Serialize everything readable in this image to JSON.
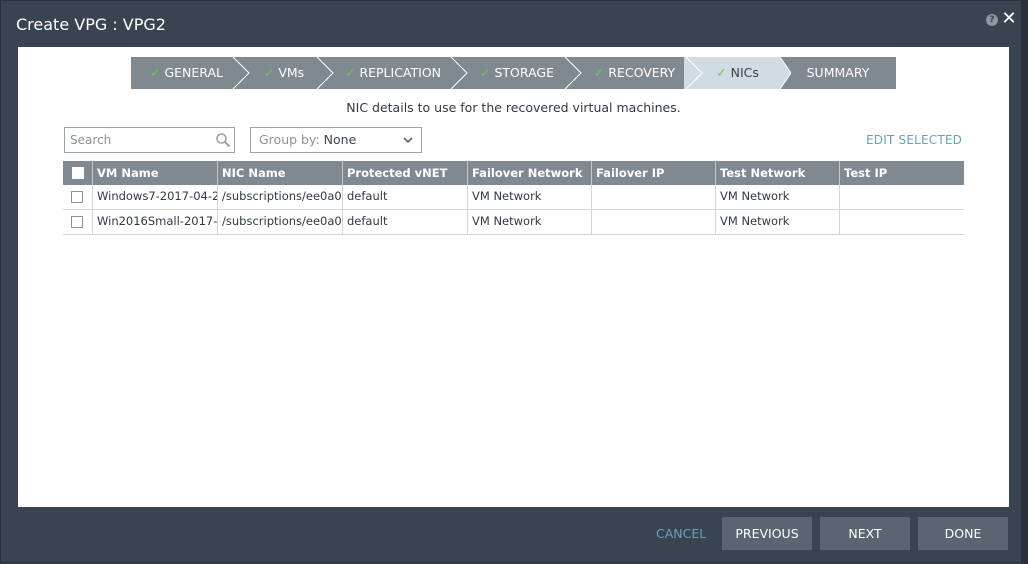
{
  "window": {
    "title": "Create VPG : VPG2",
    "help_icon": "?",
    "close_icon": "✕"
  },
  "wizard": {
    "steps": [
      {
        "label": "GENERAL",
        "done": true
      },
      {
        "label": "VMs",
        "done": true
      },
      {
        "label": "REPLICATION",
        "done": true
      },
      {
        "label": "STORAGE",
        "done": true
      },
      {
        "label": "RECOVERY",
        "done": true
      },
      {
        "label": "NICs",
        "done": true,
        "active": true
      },
      {
        "label": "SUMMARY",
        "done": false
      }
    ],
    "check_glyph": "✓"
  },
  "subtitle": "NIC details to use for the recovered virtual machines.",
  "toolbar": {
    "search_placeholder": "Search",
    "group_by_label": "Group by:",
    "group_by_value": "None",
    "edit_selected": "EDIT SELECTED"
  },
  "table": {
    "columns": [
      "VM Name",
      "NIC Name",
      "Protected vNET",
      "Failover Network",
      "Failover IP",
      "Test Network",
      "Test IP"
    ],
    "rows": [
      [
        "Windows7-2017-04-2",
        "/subscriptions/ee0a0",
        "default",
        "VM Network",
        "",
        "VM Network",
        ""
      ],
      [
        "Win2016Small-2017-",
        "/subscriptions/ee0a0",
        "default",
        "VM Network",
        "",
        "VM Network",
        ""
      ]
    ]
  },
  "footer": {
    "cancel": "CANCEL",
    "previous": "PREVIOUS",
    "next": "NEXT",
    "done": "DONE"
  },
  "colors": {
    "step_bg": "#808890",
    "step_active_bg": "#d0dbe4",
    "check": "#6ccc3a",
    "link": "#6aa1b8",
    "button": "#5b6470"
  }
}
